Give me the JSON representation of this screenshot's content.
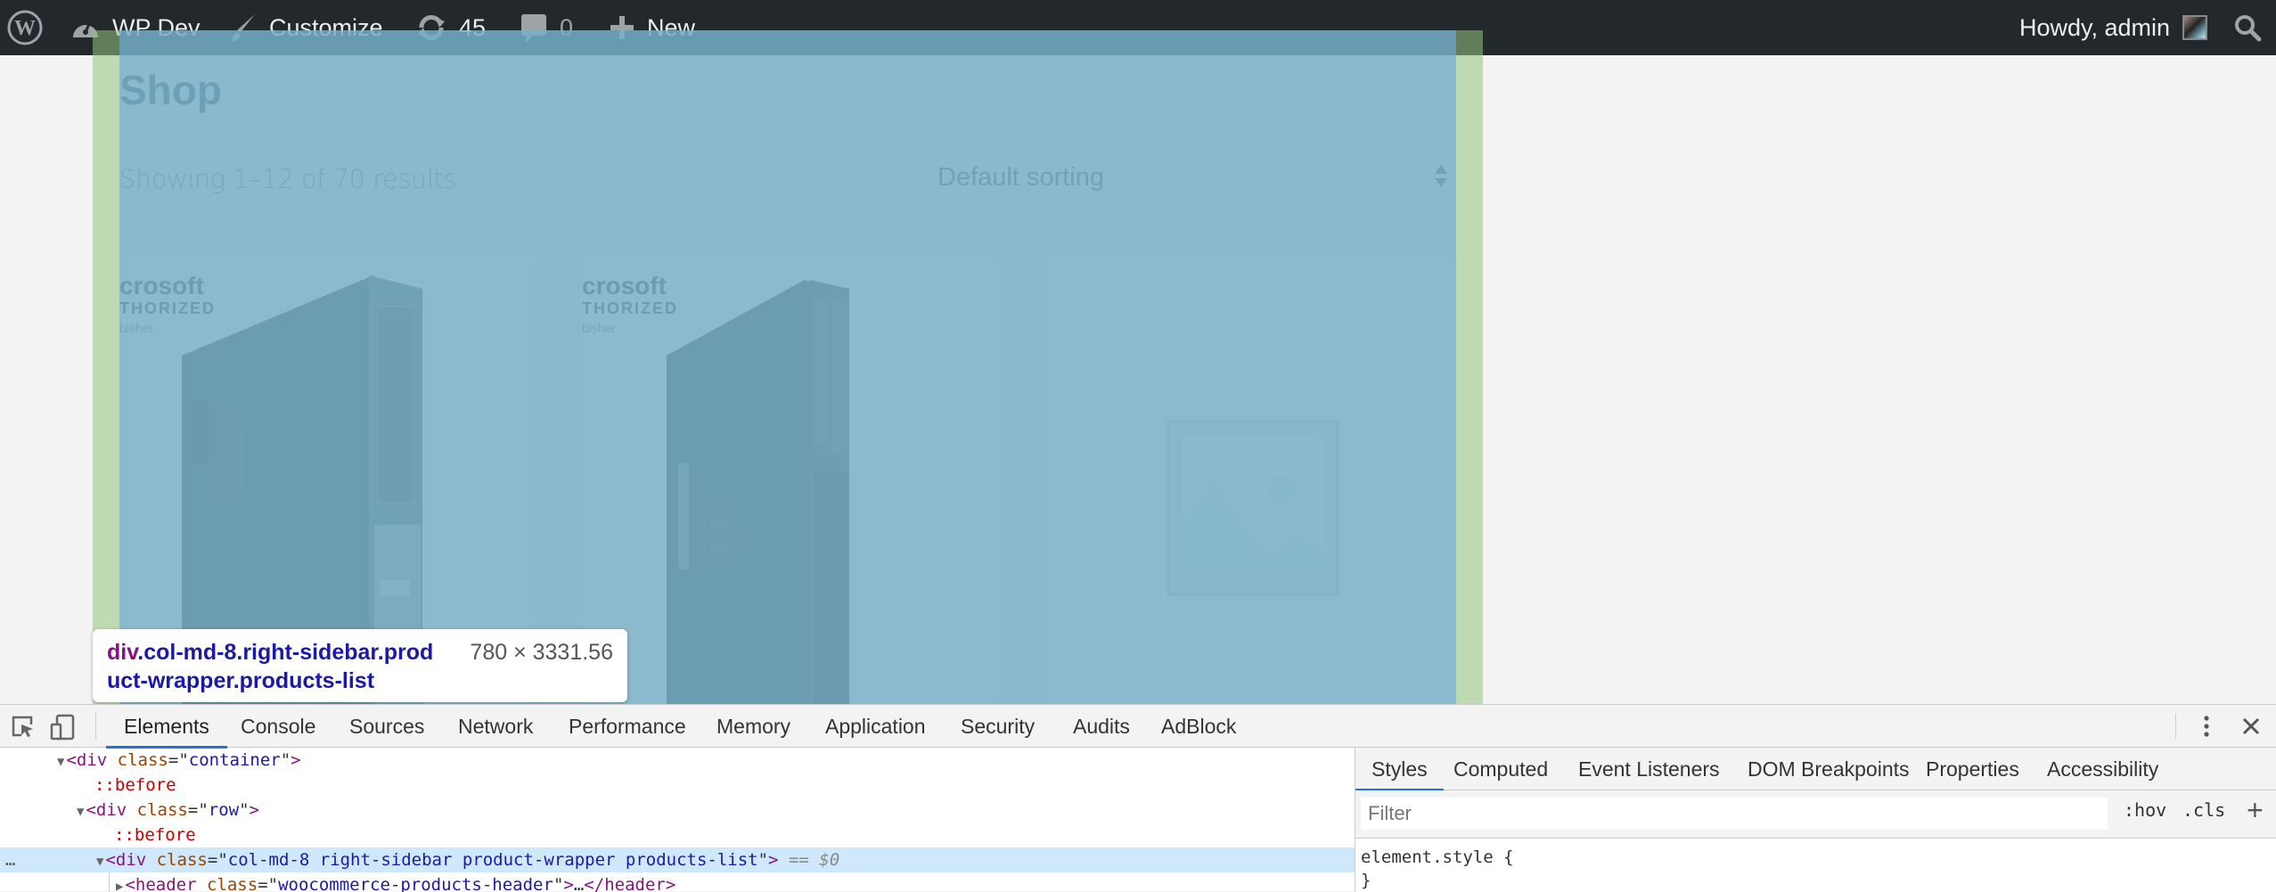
{
  "admin_bar": {
    "site_name": "WP Dev",
    "customize_label": "Customize",
    "updates_count": "45",
    "comments_count": "0",
    "new_label": "New",
    "howdy": "Howdy, admin",
    "icons": [
      "wordpress-logo-icon",
      "dashboard-icon",
      "customize-brush-icon",
      "updates-icon",
      "comments-icon",
      "plus-icon",
      "avatar",
      "search-icon"
    ]
  },
  "page": {
    "title": "Shop",
    "result_count": "Showing 1–12 of 70 results",
    "sorting": {
      "selected": "Default sorting"
    },
    "products": [
      {
        "image": "dell-desktop-tower",
        "brand_line1": "crosoft",
        "brand_line2": "THORIZED",
        "brand_line3": "bisher"
      },
      {
        "image": "hp-desktop-tower",
        "brand_line1": "crosoft",
        "brand_line2": "THORIZED",
        "brand_line3": "bisher"
      },
      {
        "image": "placeholder-image"
      }
    ]
  },
  "inspector": {
    "tag": "div",
    "classes_line1": ".col-md-8.right-sidebar.prod",
    "classes_line2": "uct-wrapper.products-list",
    "dimensions": "780 × 3331.56",
    "overlay_content_color": "#6fa8dc",
    "overlay_padding_color": "#93c47d"
  },
  "devtools": {
    "tabs": [
      "Elements",
      "Console",
      "Sources",
      "Network",
      "Performance",
      "Memory",
      "Application",
      "Security",
      "Audits",
      "AdBlock"
    ],
    "active_tab": "Elements",
    "dom": {
      "line1": {
        "tag": "div",
        "attr": "class",
        "value": "container"
      },
      "line2": "::before",
      "line3": {
        "tag": "div",
        "attr": "class",
        "value": "row"
      },
      "line4": "::before",
      "line5": {
        "tag": "div",
        "attr": "class",
        "value": "col-md-8 right-sidebar product-wrapper products-list",
        "suffix": "== $0"
      },
      "line6": {
        "tag": "header",
        "attr": "class",
        "value": "woocommerce-products-header",
        "ellipsis": "…",
        "close": "header"
      }
    },
    "styles_tabs": [
      "Styles",
      "Computed",
      "Event Listeners",
      "DOM Breakpoints",
      "Properties",
      "Accessibility"
    ],
    "styles_active_tab": "Styles",
    "filter_placeholder": "Filter",
    "hov_label": ":hov",
    "cls_label": ".cls",
    "rule_selector": "element.style {",
    "rule_close": "}",
    "accent_color": "#1a73e8"
  }
}
